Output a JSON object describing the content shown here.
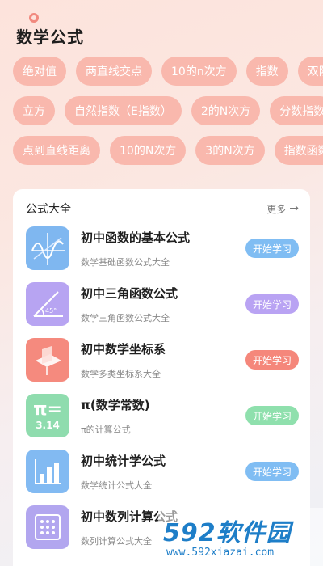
{
  "header": {
    "title": "数学公式"
  },
  "tags": {
    "row1": [
      "绝对值",
      "两直线交点",
      "10的n次方",
      "指数",
      "双队"
    ],
    "row2": [
      "立方",
      "自然指数（E指数）",
      "2的N次方",
      "分数指数"
    ],
    "row3": [
      "点到直线距离",
      "10的N次方",
      "3的N次方",
      "指数函数"
    ]
  },
  "card": {
    "title": "公式大全",
    "more_label": "更多"
  },
  "items": [
    {
      "title": "初中函数的基本公式",
      "subtitle": "数学基础函数公式大全",
      "button": "开始学习",
      "thumb_color": "#7fb7f0",
      "button_color": "#80bdf3"
    },
    {
      "title": "初中三角函数公式",
      "subtitle": "数学三角函数公式大全",
      "button": "开始学习",
      "thumb_color": "#b7a4f2",
      "button_color": "#b9a3f3"
    },
    {
      "title": "初中数学坐标系",
      "subtitle": "数学多类坐标系大全",
      "button": "开始学习",
      "thumb_color": "#f58a7e",
      "button_color": "#f5877b"
    },
    {
      "title": "π(数学常数)",
      "subtitle": "π的计算公式",
      "button": "开始学习",
      "thumb_color": "#8fdcae",
      "button_color": "#8fe0ad"
    },
    {
      "title": "初中统计学公式",
      "subtitle": "数学统计公式大全",
      "button": "开始学习",
      "thumb_color": "#82baf2",
      "button_color": "#80bdf3"
    },
    {
      "title": "初中数列计算公式",
      "subtitle": "数列计算公式大全",
      "button": "开始学习",
      "thumb_color": "#b2a6ef",
      "button_color": "#b9a3f3"
    }
  ],
  "thumb_labels": {
    "pi_symbol": "π=",
    "pi_value": "3.14",
    "angle": "45°"
  },
  "watermark": {
    "main": "592软件园",
    "sub": "www.592xiazai.com"
  }
}
